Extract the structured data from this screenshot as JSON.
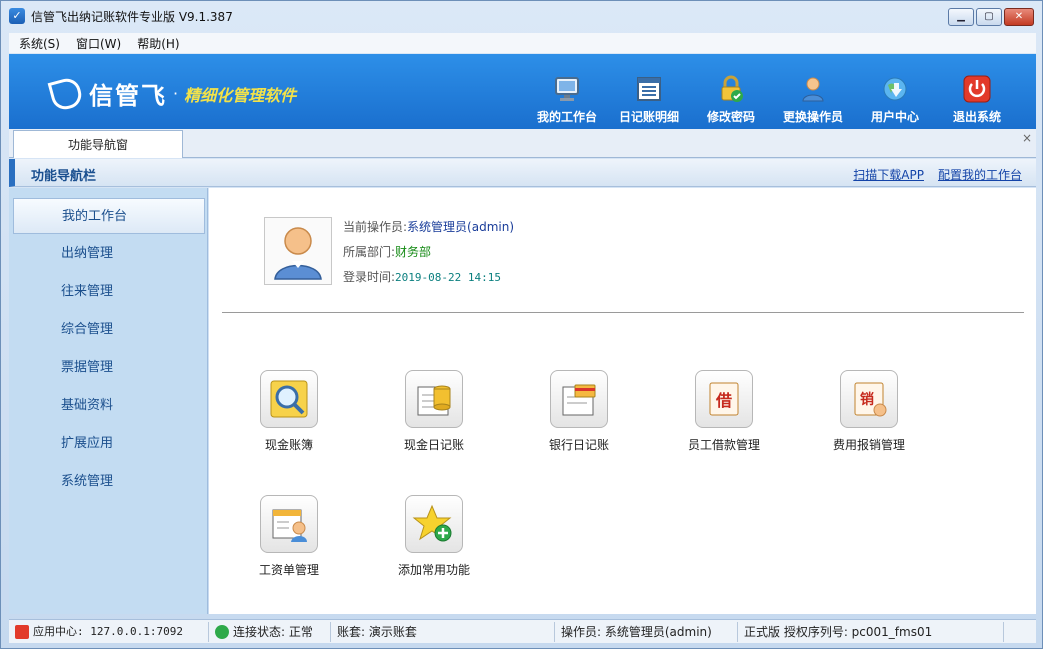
{
  "window": {
    "title": "信管飞出纳记账软件专业版 V9.1.387",
    "controls": [
      "minimize",
      "maximize",
      "close"
    ]
  },
  "menubar": {
    "items": [
      "系统(S)",
      "窗口(W)",
      "帮助(H)"
    ]
  },
  "banner": {
    "logo_name": "信管飞",
    "logo_dot": "·",
    "slogan": "精细化管理软件",
    "tools": [
      {
        "label": "我的工作台",
        "icon": "monitor-icon"
      },
      {
        "label": "日记账明细",
        "icon": "ledger-list-icon"
      },
      {
        "label": "修改密码",
        "icon": "lock-check-icon"
      },
      {
        "label": "更换操作员",
        "icon": "user-switch-icon"
      },
      {
        "label": "用户中心",
        "icon": "globe-arrow-icon"
      },
      {
        "label": "退出系统",
        "icon": "power-icon"
      }
    ]
  },
  "tabstrip": {
    "active_tab": "功能导航窗",
    "close_glyph": "×"
  },
  "navhead": {
    "title": "功能导航栏",
    "links": [
      "扫描下载APP",
      "配置我的工作台"
    ]
  },
  "sidebar": {
    "items": [
      "我的工作台",
      "出纳管理",
      "往来管理",
      "综合管理",
      "票据管理",
      "基础资料",
      "扩展应用",
      "系统管理"
    ],
    "active_index": 0
  },
  "profile": {
    "operator_label": "当前操作员:",
    "operator_value": "系统管理员(admin)",
    "dept_label": "所属部门:",
    "dept_value": "财务部",
    "login_label": "登录时间:",
    "login_value": "2019-08-22 14:15"
  },
  "functions": [
    {
      "label": "现金账簿",
      "icon": "magnifier-book-icon"
    },
    {
      "label": "现金日记账",
      "icon": "coin-journal-icon"
    },
    {
      "label": "银行日记账",
      "icon": "bank-journal-icon"
    },
    {
      "label": "员工借款管理",
      "icon": "borrow-note-icon"
    },
    {
      "label": "费用报销管理",
      "icon": "reimburse-note-icon"
    },
    {
      "label": "工资单管理",
      "icon": "payroll-sheet-icon"
    },
    {
      "label": "添加常用功能",
      "icon": "star-add-icon"
    }
  ],
  "statusbar": {
    "app_center": "应用中心: 127.0.0.1:7092",
    "connection": "连接状态: 正常",
    "account_set": "账套: 演示账套",
    "operator": "操作员: 系统管理员(admin)",
    "license": "正式版 授权序列号: pc001_fms01"
  },
  "colors": {
    "banner": "#1a6fce",
    "slogan": "#f2e24a",
    "sidebar_bg": "#c3dcf2",
    "link": "#1444a8",
    "dept_value": "#148a14"
  }
}
